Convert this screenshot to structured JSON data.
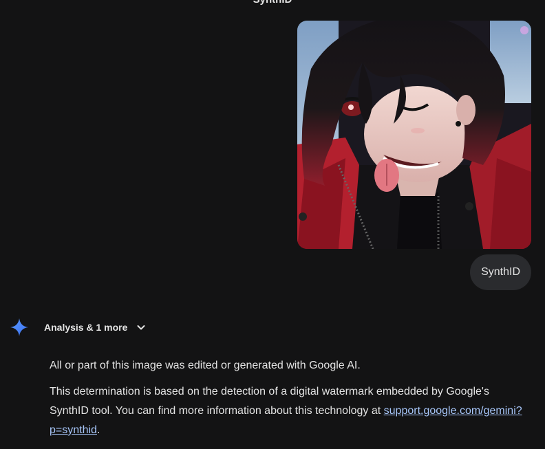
{
  "header": {
    "title": "SynthID"
  },
  "user_message": {
    "image_alt": "Anime-style character with black and red hair, winking and sticking out tongue, wearing a red and black jacket",
    "text": "SynthID"
  },
  "response": {
    "icon": "gemini-sparkle-icon",
    "header_label": "Analysis & 1 more",
    "paragraph1": "All or part of this image was edited or generated with Google AI.",
    "paragraph2_text": "This determination is based on the detection of a digital watermark embedded by Google's SynthID tool. You can find more information about this technology at ",
    "link_text": "support.google.com/gemini?p=synthid",
    "paragraph2_end": "."
  },
  "colors": {
    "background": "#131314",
    "bubble": "#2a2b2e",
    "link": "#a8c7fa",
    "sparkle_blue": "#4285f4"
  }
}
